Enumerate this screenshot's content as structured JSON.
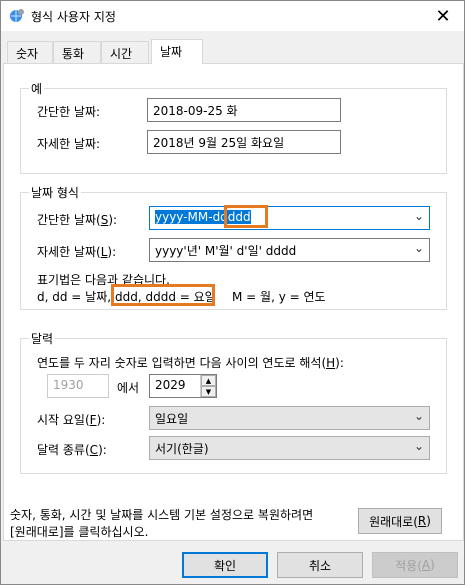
{
  "window": {
    "title": "형식 사용자 지정"
  },
  "tabs": [
    {
      "label": "숫자"
    },
    {
      "label": "통화"
    },
    {
      "label": "시간"
    },
    {
      "label": "날짜"
    }
  ],
  "example": {
    "group_title": "예",
    "short_label": "간단한 날짜:",
    "short_value": "2018-09-25 화",
    "long_label": "자세한 날짜:",
    "long_value": "2018년 9월 25일 화요일"
  },
  "format": {
    "group_title": "날짜 형식",
    "short_label_pre": "간단한 날짜(",
    "short_label_key": "S",
    "short_label_post": "):",
    "short_value_selected": "yyyy-MM-dd",
    "short_value_highlight": "ddd",
    "long_label_pre": "자세한 날짜(",
    "long_label_key": "L",
    "long_label_post": "):",
    "long_value": "yyyy'년' M'월' d'일' dddd",
    "notation_line1": "표기법은 다음과 같습니다.",
    "notation_part1": "d, dd = 날짜,",
    "notation_part2": "ddd, dddd = 요일",
    "notation_part3": "M = 월,  y = 연도"
  },
  "calendar": {
    "group_title": "달력",
    "twodigit_label_pre": "연도를 두 자리 숫자로 입력하면 다음 사이의 연도로 해석(",
    "twodigit_label_key": "H",
    "twodigit_label_post": "):",
    "year_from": "1930",
    "between": "에서",
    "year_to": "2029",
    "first_day_label_pre": "시작 요일(",
    "first_day_label_key": "F",
    "first_day_label_post": "):",
    "first_day_value": "일요일",
    "type_label_pre": "달력 종류(",
    "type_label_key": "C",
    "type_label_post": "):",
    "type_value": "서기(한글)"
  },
  "reset": {
    "text_line1": "숫자, 통화, 시간 및 날짜를 시스템 기본 설정으로 복원하려면",
    "text_line2": "[원래대로]를 클릭하십시오.",
    "button_pre": "원래대로(",
    "button_key": "R",
    "button_post": ")"
  },
  "footer": {
    "ok": "확인",
    "cancel": "취소",
    "apply_pre": "적용(",
    "apply_key": "A",
    "apply_post": ")"
  }
}
